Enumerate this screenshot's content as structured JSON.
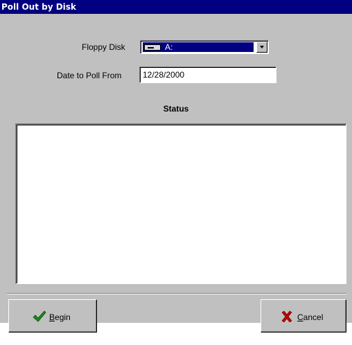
{
  "window": {
    "title": "Poll Out by Disk"
  },
  "form": {
    "floppy_label": "Floppy Disk",
    "floppy_value": "A:",
    "date_label": "Date to Poll From",
    "date_value": "12/28/2000"
  },
  "status": {
    "heading": "Status",
    "content": ""
  },
  "buttons": {
    "begin_mnemonic": "B",
    "begin_rest": "egin",
    "begin_icon": "checkmark-icon",
    "cancel_mnemonic": "C",
    "cancel_rest": "ancel",
    "cancel_icon": "x-icon"
  },
  "colors": {
    "titlebar": "#000080",
    "face": "#c0c0c0",
    "check": "#1a8a1a",
    "cross": "#c00000"
  }
}
